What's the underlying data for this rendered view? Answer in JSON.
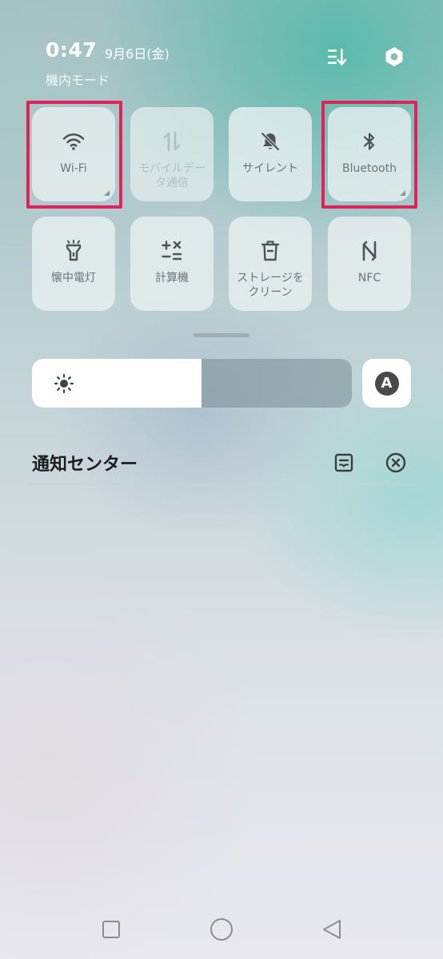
{
  "status": {
    "time": "0:47",
    "date": "9月6日(金)",
    "mode": "機内モード"
  },
  "header_icons": {
    "edit": "edit-sort-icon",
    "settings": "settings-hexagon-icon"
  },
  "tiles": [
    {
      "label": "Wi-Fi",
      "icon": "wifi-icon",
      "active": true,
      "highlighted": true
    },
    {
      "label": "モバイルデー\nタ通信",
      "icon": "mobile-data-icon",
      "active": false,
      "highlighted": false
    },
    {
      "label": "サイレント",
      "icon": "bell-off-icon",
      "active": true,
      "highlighted": false
    },
    {
      "label": "Bluetooth",
      "icon": "bluetooth-icon",
      "active": true,
      "highlighted": true
    },
    {
      "label": "懐中電灯",
      "icon": "flashlight-icon",
      "active": true,
      "highlighted": false
    },
    {
      "label": "計算機",
      "icon": "calculator-icon",
      "active": true,
      "highlighted": false
    },
    {
      "label": "ストレージを\nクリーン",
      "icon": "trash-icon",
      "active": true,
      "highlighted": false
    },
    {
      "label": "NFC",
      "icon": "nfc-icon",
      "active": true,
      "highlighted": false
    }
  ],
  "brightness": {
    "level": 0.53,
    "icon": "sun-icon",
    "auto_label": "A"
  },
  "notification_center": {
    "title": "通知センター",
    "manage_icon": "notification-manage-icon",
    "clear_icon": "clear-all-icon"
  },
  "highlight_color": "#e4205a",
  "nav": {
    "recents": "recents-square-icon",
    "home": "home-circle-icon",
    "back": "back-triangle-icon"
  }
}
